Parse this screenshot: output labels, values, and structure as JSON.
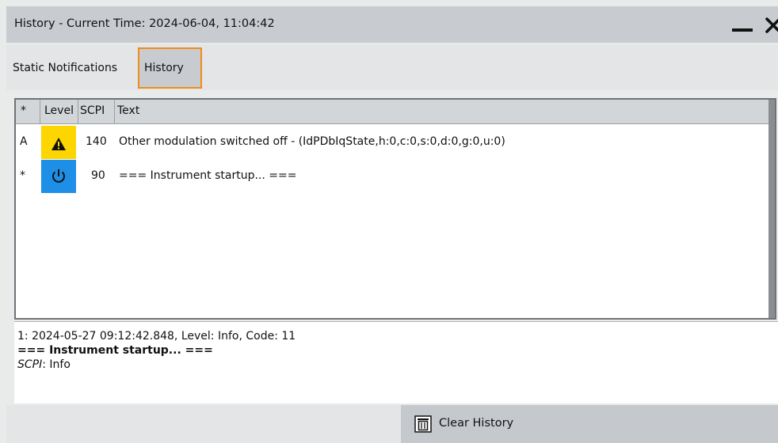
{
  "window": {
    "title": "History - Current Time: 2024-06-04, 11:04:42"
  },
  "tabs": [
    {
      "label": "Static Notifications"
    },
    {
      "label": "History",
      "selected": true
    }
  ],
  "table": {
    "columns": [
      "*",
      "Level",
      "SCPI",
      "Text"
    ],
    "rows": [
      {
        "marker": "A",
        "level": "warning",
        "scpi": "140",
        "text": "Other modulation switched off - (IdPDbIqState,h:0,c:0,s:0,d:0,g:0,u:0)"
      },
      {
        "marker": "*",
        "level": "info",
        "scpi": "90",
        "text": "=== Instrument startup... ==="
      }
    ]
  },
  "detail": {
    "header": "1: 2024-05-27 09:12:42.848, Level: Info, Code: 11",
    "message": "=== Instrument startup... ===",
    "scpi_label": "SCPI",
    "scpi_value": ": Info"
  },
  "actions": {
    "clear_history_label": "Clear History"
  },
  "icons": {
    "warning": "warning-triangle-icon",
    "info": "power-icon",
    "clear": "trash-icon"
  },
  "colors": {
    "selected_tab_border": "#f08b1c",
    "warning_level": "#fdd600",
    "info_level": "#1e8fe6"
  }
}
